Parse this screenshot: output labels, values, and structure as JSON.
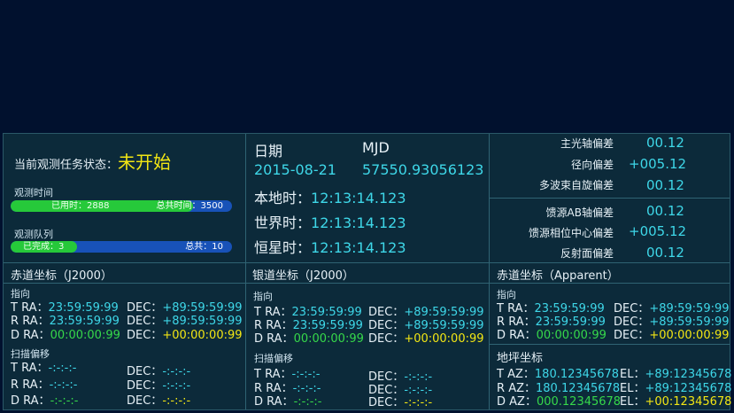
{
  "status": {
    "label": "当前观测任务状态：",
    "value": "未开始"
  },
  "time_progress": {
    "title": "观测时间",
    "used": "已用时：2888",
    "total": "总共时间：3500",
    "fraction": 0.825
  },
  "queue_progress": {
    "title": "观测队列",
    "done": "已完成：3",
    "total": "总共：10",
    "fraction": 0.3
  },
  "datetime": {
    "date_label": "日期",
    "mjd_label": "MJD",
    "date": "2015-08-21",
    "mjd": "57550.93056123",
    "local_label": "本地时：",
    "local": "12:13:14.123",
    "world_label": "世界时：",
    "world": "12:13:14.123",
    "sidereal_label": "恒星时：",
    "sidereal": "12:13:14.123"
  },
  "deviations": {
    "main_axis_label": "主光轴偏差",
    "main_axis": "00.12",
    "radial_label": "径向偏差",
    "radial": "+005.12",
    "multibeam_label": "多波束自旋偏差",
    "multibeam": "00.12",
    "feed_ab_label": "馈源AB轴偏差",
    "feed_ab": "00.12",
    "feed_phase_label": "馈源相位中心偏差",
    "feed_phase": "+005.12",
    "reflector_label": "反射面偏差",
    "reflector": "00.12"
  },
  "panels": {
    "eq": {
      "title": "赤道坐标（J2000）",
      "pointing": "指向",
      "T": {
        "p": "T",
        "ra": "RA：",
        "ra_v": "23:59:59:99",
        "dec": "DEC：",
        "dec_v": "+89:59:59:99"
      },
      "R": {
        "p": "R",
        "ra": "RA：",
        "ra_v": "23:59:59:99",
        "dec": "DEC：",
        "dec_v": "+89:59:59:99"
      },
      "D": {
        "p": "D",
        "ra": "RA：",
        "ra_v": "00:00:00:99",
        "dec": "DEC：",
        "dec_v": "+00:00:00:99"
      },
      "scan": "扫描偏移",
      "sT": {
        "p": "T",
        "ra": "RA：",
        "ra_v": "-:-:-:-",
        "dec": "DEC：",
        "dec_v": "-:-:-:-"
      },
      "sR": {
        "p": "R",
        "ra": "RA：",
        "ra_v": "-:-:-:-",
        "dec": "DEC：",
        "dec_v": "-:-:-:-"
      },
      "sD": {
        "p": "D",
        "ra": "RA：",
        "ra_v": "-:-:-:-",
        "dec": "DEC：",
        "dec_v": "-:-:-:-"
      }
    },
    "gal": {
      "title": "银道坐标（J2000）",
      "pointing": "指向",
      "T": {
        "p": "T",
        "ra": "RA：",
        "ra_v": "23:59:59:99",
        "dec": "DEC：",
        "dec_v": "+89:59:59:99"
      },
      "R": {
        "p": "R",
        "ra": "RA：",
        "ra_v": "23:59:59:99",
        "dec": "DEC：",
        "dec_v": "+89:59:59:99"
      },
      "D": {
        "p": "D",
        "ra": "RA：",
        "ra_v": "00:00:00:99",
        "dec": "DEC：",
        "dec_v": "+00:00:00:99"
      },
      "scan": "扫描偏移",
      "sT": {
        "p": "T",
        "ra": "RA：",
        "ra_v": "-:-:-:-",
        "dec": "DEC：",
        "dec_v": "-:-:-:-"
      },
      "sR": {
        "p": "R",
        "ra": "RA：",
        "ra_v": "-:-:-:-",
        "dec": "DEC：",
        "dec_v": "-:-:-:-"
      },
      "sD": {
        "p": "D",
        "ra": "RA：",
        "ra_v": "-:-:-:-",
        "dec": "DEC：",
        "dec_v": "-:-:-:-"
      }
    },
    "app": {
      "title": "赤道坐标（Apparent）",
      "pointing": "指向",
      "T": {
        "p": "T",
        "ra": "RA：",
        "ra_v": "23:59:59:99",
        "dec": "DEC：",
        "dec_v": "+89:59:59:99"
      },
      "R": {
        "p": "R",
        "ra": "RA：",
        "ra_v": "23:59:59:99",
        "dec": "DEC：",
        "dec_v": "+89:59:59:99"
      },
      "D": {
        "p": "D",
        "ra": "RA：",
        "ra_v": "00:00:00:99",
        "dec": "DEC：",
        "dec_v": "+00:00:00:99"
      },
      "horizon": "地坪坐标",
      "hT": {
        "p": "T",
        "az": "AZ：",
        "az_v": "180.12345678",
        "el": "EL：",
        "el_v": "+89:12345678"
      },
      "hR": {
        "p": "R",
        "az": "AZ：",
        "az_v": "180.12345678",
        "el": "EL：",
        "el_v": "+89:12345678"
      },
      "hD": {
        "p": "D",
        "az": "AZ：",
        "az_v": "000.12345678",
        "el": "EL：",
        "el_v": "+00:12345678"
      }
    }
  },
  "colors": {
    "background": "#01112e",
    "panel": "#0c2a3a",
    "cyan": "#3ed7e8",
    "yellow": "#f2e614",
    "green": "#36d84a",
    "bar_blue": "#1852b8",
    "bar_green": "#26c93a"
  }
}
